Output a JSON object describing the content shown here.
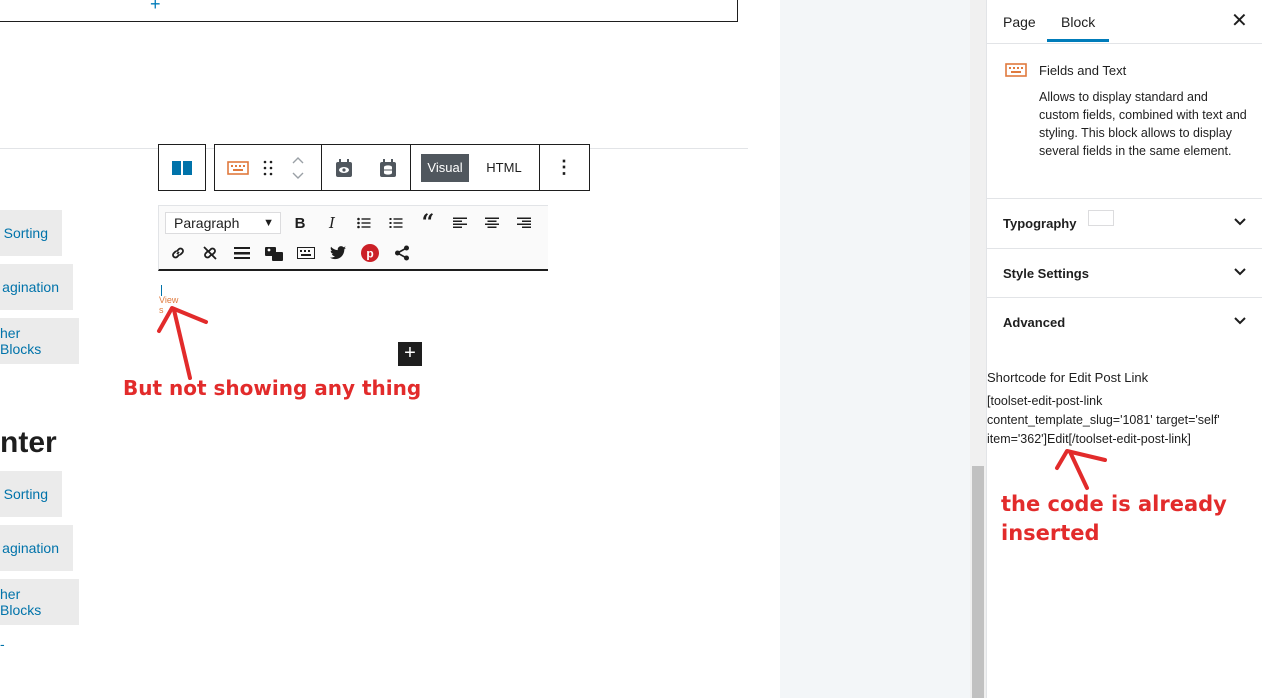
{
  "editor": {
    "top_block_plus": "+",
    "pills_group1": [
      "Sorting",
      "agination",
      "her Blocks"
    ],
    "heading_fragment": "nter",
    "pills_group2": [
      "Sorting",
      "agination",
      "her Blocks"
    ],
    "block_toolbar": {
      "visual_label": "Visual",
      "html_label": "HTML",
      "more_label": "⋮"
    },
    "mce": {
      "format_select": "Paragraph"
    },
    "views_text_line1": "View",
    "views_text_line2": "s",
    "add_block_label": "+"
  },
  "annotations": {
    "left": "But not showing any thing",
    "right_line1": "the code is already",
    "right_line2": "inserted"
  },
  "sidebar": {
    "tabs": [
      "Page",
      "Block"
    ],
    "active_tab": "Block",
    "close_label": "✕",
    "block_card": {
      "icon": "keyboard-icon",
      "title": "Fields and Text",
      "description": "Allows to display standard and custom fields, combined with text and styling. This block allows to display several fields in the same element."
    },
    "panels": [
      "Typography",
      "Style Settings",
      "Advanced"
    ],
    "shortcode_title": "Shortcode for Edit Post Link",
    "shortcode_lines": [
      "[toolset-edit-post-link",
      "content_template_slug='1081' target='self'",
      "item='362']Edit[/toolset-edit-post-link]"
    ]
  },
  "colors": {
    "accent": "#007cba",
    "annotation_red": "#e22b2b",
    "orange_icon": "#e07a3e"
  }
}
